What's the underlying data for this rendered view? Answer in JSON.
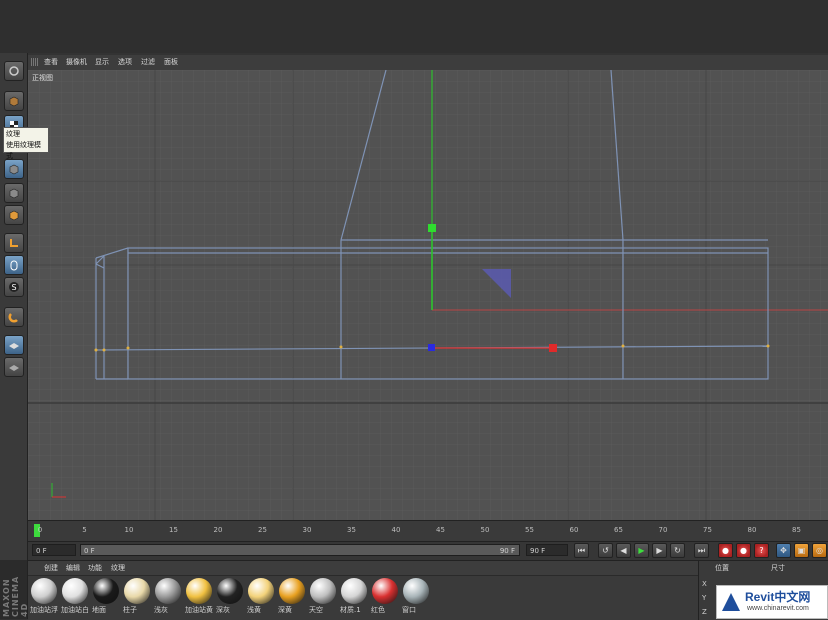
{
  "toolbar": {
    "tooltip": {
      "title": "纹理",
      "description": "使用纹理模式"
    }
  },
  "viewport": {
    "menu": [
      "查看",
      "摄像机",
      "显示",
      "选项",
      "过滤",
      "面板"
    ],
    "label": "正视图"
  },
  "timeline": {
    "ticks": [
      "0",
      "5",
      "10",
      "15",
      "20",
      "25",
      "30",
      "35",
      "40",
      "45",
      "50",
      "55",
      "60",
      "65",
      "70",
      "75",
      "80",
      "85"
    ],
    "current_frame_field": "0 F",
    "range_start": "0 F",
    "range_end": "90 F",
    "end_field": "90 F"
  },
  "material_manager": {
    "menu": [
      "创建",
      "编辑",
      "功能",
      "纹理"
    ],
    "materials": [
      {
        "label": "加油站浮",
        "color": "#cfcfcf"
      },
      {
        "label": "加油站白",
        "color": "#e0e0e0"
      },
      {
        "label": "地面",
        "color": "#1a1a1a"
      },
      {
        "label": "柱子",
        "color": "#e8d8a8"
      },
      {
        "label": "浅灰",
        "color": "#9a9a9a"
      },
      {
        "label": "加油站黄",
        "color": "#f0c040"
      },
      {
        "label": "深灰",
        "color": "#222222"
      },
      {
        "label": "浅黄",
        "color": "#f3d27a"
      },
      {
        "label": "深黄",
        "color": "#e8a020"
      },
      {
        "label": "天空",
        "color": "#bfbfbf"
      },
      {
        "label": "材质.1",
        "color": "#d5d5d5"
      },
      {
        "label": "红色",
        "color": "#d93030"
      },
      {
        "label": "窗口",
        "color": "#a8b4b8"
      }
    ]
  },
  "coordinates": {
    "headers": [
      "位置",
      "尺寸"
    ],
    "axes": [
      "X",
      "Y",
      "Z"
    ]
  },
  "branding": {
    "side_logo": "MAXON CINEMA 4D",
    "watermark_title": "Revit中文网",
    "watermark_url": "www.chinarevit.com"
  },
  "colors": {
    "accent": "#3d6388",
    "viewport_bg": "#525252",
    "wire": "#7f93b5"
  }
}
